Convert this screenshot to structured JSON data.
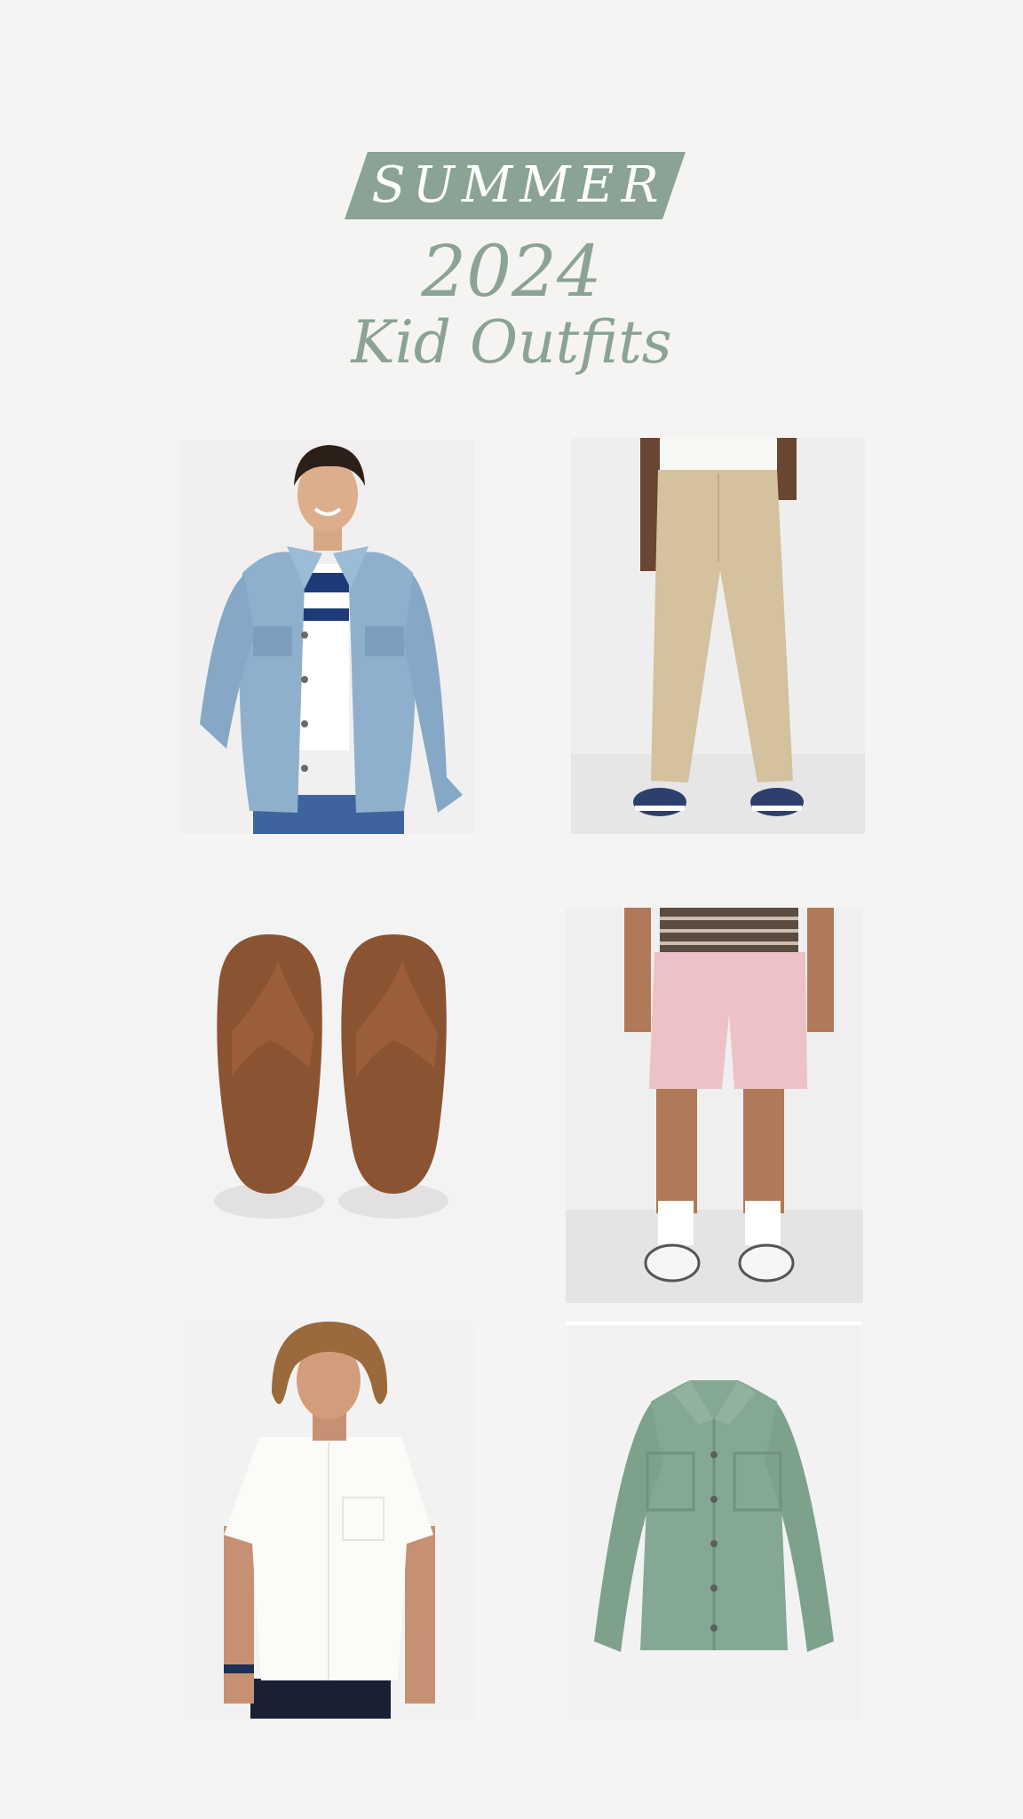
{
  "header": {
    "banner_text": "SUMMER",
    "year": "2024",
    "subtitle": "Kid Outfits"
  },
  "colors": {
    "page_background": "#f6f4f3",
    "accent_sage": "#8aa394",
    "banner_text": "#ffffff"
  },
  "tiles": [
    {
      "item": "light-wash-denim-jacket"
    },
    {
      "item": "khaki-chino-pants"
    },
    {
      "item": "brown-flip-flop-sandals"
    },
    {
      "item": "pink-chino-shorts"
    },
    {
      "item": "white-short-sleeve-button-shirt"
    },
    {
      "item": "sage-green-shirt-jacket"
    }
  ]
}
